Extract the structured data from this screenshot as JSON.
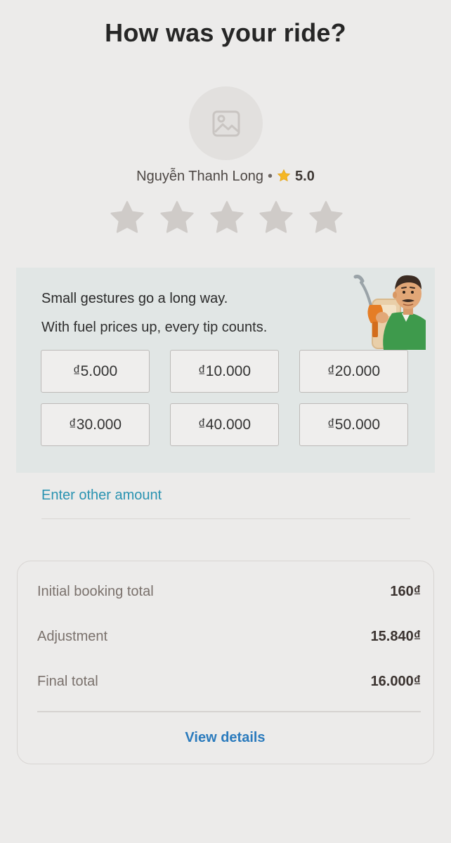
{
  "header": {
    "title": "How was your ride?"
  },
  "driver": {
    "avatar_icon": "image-placeholder-icon",
    "name": "Nguyễn Thanh Long",
    "separator": "•",
    "rating": "5.0",
    "rating_icon": "star-icon",
    "rating_icon_color": "#f5b724"
  },
  "rating_input": {
    "max_stars": 5,
    "selected": 0,
    "star_color": "#cfcbc8"
  },
  "tips": {
    "title": "Small gestures go a long way.",
    "subtitle": "With fuel prices up, every tip counts.",
    "illustration": "driver-with-fuel-nozzle-illustration",
    "options": [
      "₫5.000",
      "₫10.000",
      "₫20.000",
      "₫30.000",
      "₫40.000",
      "₫50.000"
    ],
    "other_amount_label": "Enter other amount",
    "panel_color": "#e1e6e5"
  },
  "summary": {
    "rows": [
      {
        "label": "Initial booking total",
        "value": "160₫"
      },
      {
        "label": "Adjustment",
        "value": "15.840₫"
      },
      {
        "label": "Final total",
        "value": "16.000₫"
      }
    ],
    "view_details_label": "View details"
  },
  "colors": {
    "background": "#ecebea",
    "link": "#2a93b1",
    "accent_link": "#2b7bbd"
  }
}
